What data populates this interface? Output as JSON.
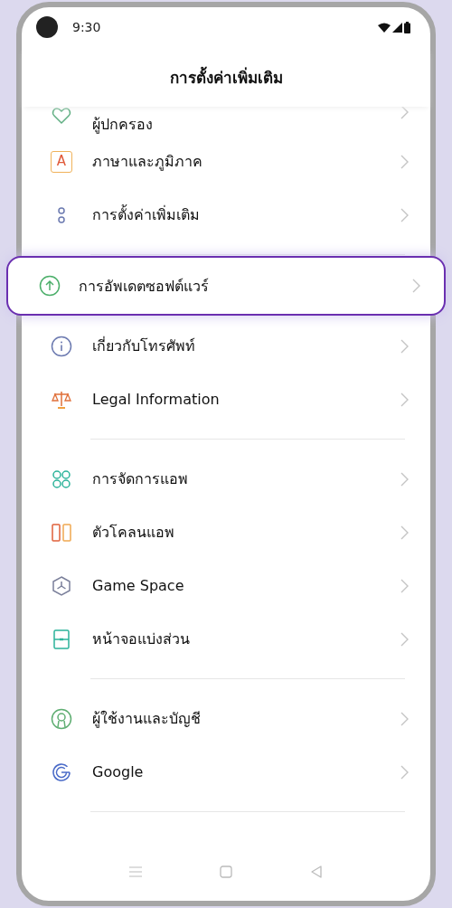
{
  "status_bar": {
    "time": "9:30"
  },
  "header": {
    "title": "การตั้งค่าเพิ่มเติม"
  },
  "groups": [
    {
      "items": [
        {
          "kind": "heart",
          "label": "ผู้ปกครอง",
          "selected": false
        },
        {
          "kind": "letter",
          "badge": "A",
          "label": "ภาษาและภูมิภาค",
          "selected": false
        },
        {
          "kind": "dots",
          "label": "การตั้งค่าเพิ่มเติม",
          "selected": false
        }
      ]
    },
    {
      "items": [
        {
          "kind": "update",
          "label": "การอัพเดตซอฟต์แวร์",
          "selected": true
        },
        {
          "kind": "info",
          "label": "เกี่ยวกับโทรศัพท์",
          "selected": false
        },
        {
          "kind": "scales",
          "label": "Legal Information",
          "selected": false
        }
      ]
    },
    {
      "items": [
        {
          "kind": "apps",
          "label": "การจัดการแอพ",
          "selected": false
        },
        {
          "kind": "clone",
          "label": "ตัวโคลนแอพ",
          "selected": false
        },
        {
          "kind": "game",
          "label": "Game Space",
          "selected": false
        },
        {
          "kind": "split",
          "label": "หน้าจอแบ่งส่วน",
          "selected": false
        }
      ]
    },
    {
      "items": [
        {
          "kind": "user",
          "label": "ผู้ใช้งานและบัญชี",
          "selected": false
        },
        {
          "kind": "google",
          "label": "Google",
          "selected": false
        }
      ]
    }
  ]
}
